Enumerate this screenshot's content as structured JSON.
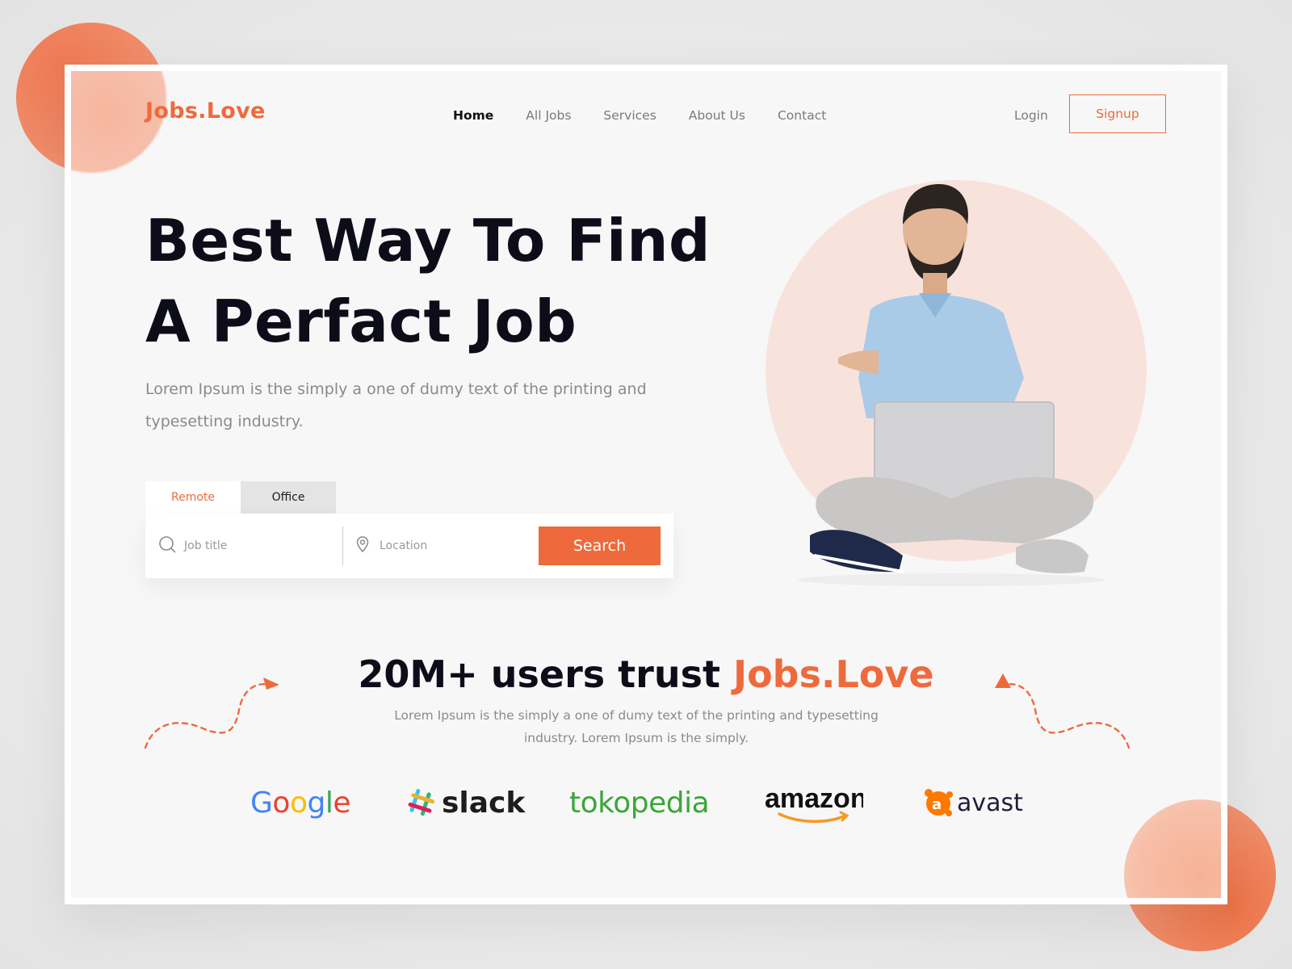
{
  "brand": {
    "name": "Jobs.Love",
    "accent_color": "#ee6a3c"
  },
  "nav": {
    "items": [
      {
        "label": "Home",
        "active": true
      },
      {
        "label": "All Jobs",
        "active": false
      },
      {
        "label": "Services",
        "active": false
      },
      {
        "label": "About Us",
        "active": false
      },
      {
        "label": "Contact",
        "active": false
      }
    ],
    "login_label": "Login",
    "signup_label": "Signup"
  },
  "hero": {
    "title_line1": "Best Way To Find",
    "title_line2": "A Perfact Job",
    "subtitle": "Lorem Ipsum is the simply a one of dumy text of the printing and typesetting industry."
  },
  "search": {
    "tabs": [
      {
        "label": "Remote",
        "active": true
      },
      {
        "label": "Office",
        "active": false
      }
    ],
    "job_placeholder": "Job title",
    "location_placeholder": "Location",
    "button_label": "Search"
  },
  "trust": {
    "title_prefix": "20M+ users trust ",
    "title_brand": "Jobs.Love",
    "subtitle": "Lorem Ipsum is the simply a one of dumy text of the printing and typesetting industry. Lorem Ipsum is the simply."
  },
  "partners": [
    {
      "name": "Google",
      "icon": "google-logo"
    },
    {
      "name": "slack",
      "icon": "slack-logo"
    },
    {
      "name": "tokopedia",
      "icon": "tokopedia-logo"
    },
    {
      "name": "amazon",
      "icon": "amazon-logo"
    },
    {
      "name": "avast",
      "icon": "avast-logo"
    }
  ]
}
